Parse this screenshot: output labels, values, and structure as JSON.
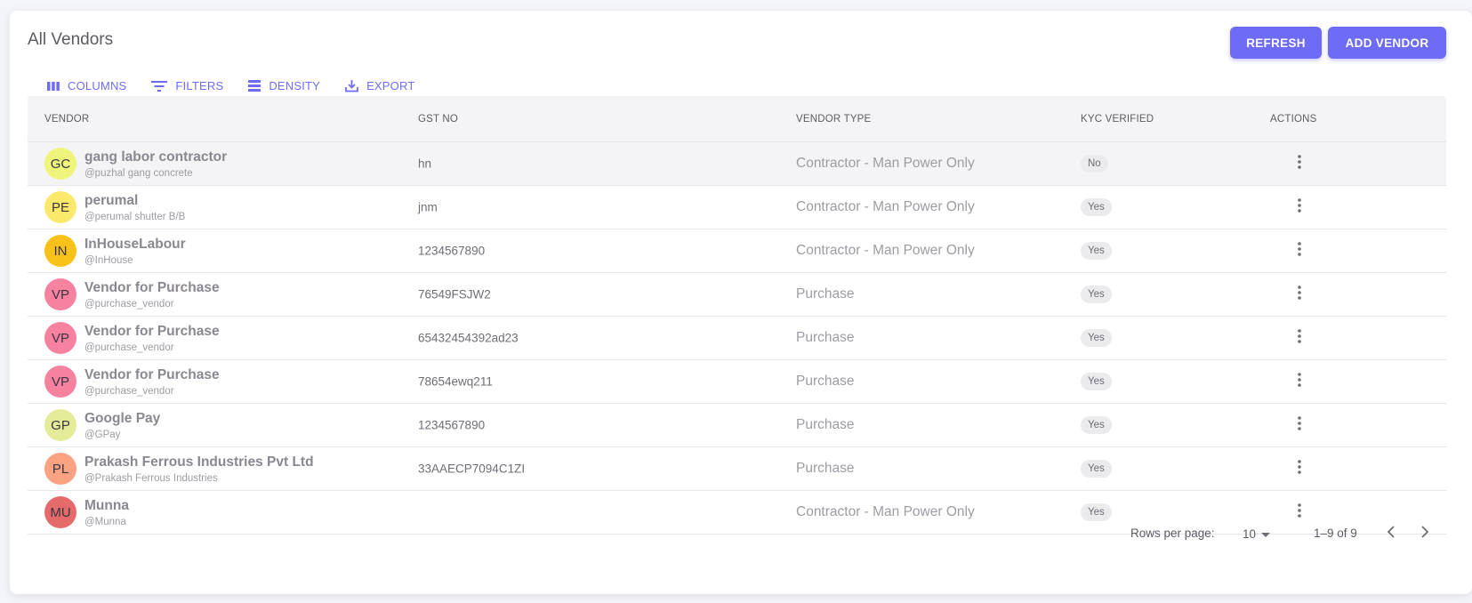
{
  "header": {
    "title": "All Vendors",
    "refresh_label": "REFRESH",
    "add_label": "ADD VENDOR"
  },
  "toolbar": {
    "columns_label": "COLUMNS",
    "filters_label": "FILTERS",
    "density_label": "DENSITY",
    "export_label": "EXPORT"
  },
  "table": {
    "headers": [
      "VENDOR",
      "GST NO",
      "VENDOR TYPE",
      "KYC VERIFIED",
      "ACTIONS"
    ],
    "rows": [
      {
        "initials": "GC",
        "name": "gang labor contractor",
        "username": "@puzhal gang concrete",
        "gst": "hn",
        "type": "Contractor - Man Power Only",
        "kyc": "No",
        "color": "#eef57a"
      },
      {
        "initials": "PE",
        "name": "perumal",
        "username": "@perumal shutter B/B",
        "gst": "jnm",
        "type": "Contractor - Man Power Only",
        "kyc": "Yes",
        "color": "#fbe96c"
      },
      {
        "initials": "IN",
        "name": "InHouseLabour",
        "username": "@InHouse",
        "gst": "1234567890",
        "type": "Contractor - Man Power Only",
        "kyc": "Yes",
        "color": "#f8c21a"
      },
      {
        "initials": "VP",
        "name": "Vendor for Purchase",
        "username": "@purchase_vendor",
        "gst": "76549FSJW2",
        "type": "Purchase",
        "kyc": "Yes",
        "color": "#f7829f"
      },
      {
        "initials": "VP",
        "name": "Vendor for Purchase",
        "username": "@purchase_vendor",
        "gst": "65432454392ad23",
        "type": "Purchase",
        "kyc": "Yes",
        "color": "#f7829f"
      },
      {
        "initials": "VP",
        "name": "Vendor for Purchase",
        "username": "@purchase_vendor",
        "gst": "78654ewq211",
        "type": "Purchase",
        "kyc": "Yes",
        "color": "#f7829f"
      },
      {
        "initials": "GP",
        "name": "Google Pay",
        "username": "@GPay",
        "gst": "1234567890",
        "type": "Purchase",
        "kyc": "Yes",
        "color": "#e4ec9a"
      },
      {
        "initials": "PL",
        "name": "Prakash Ferrous Industries Pvt Ltd",
        "username": "@Prakash Ferrous Industries",
        "gst": "33AAECP7094C1ZI",
        "type": "Purchase",
        "kyc": "Yes",
        "color": "#fba283"
      },
      {
        "initials": "MU",
        "name": "Munna",
        "username": "@Munna",
        "gst": "",
        "type": "Contractor - Man Power Only",
        "kyc": "Yes",
        "color": "#e56b6b"
      }
    ]
  },
  "pagination": {
    "rows_per_page_label": "Rows per page:",
    "rows_per_page": "10",
    "range": "1–9 of 9"
  },
  "colors": {
    "accent": "#6e6cf7"
  }
}
